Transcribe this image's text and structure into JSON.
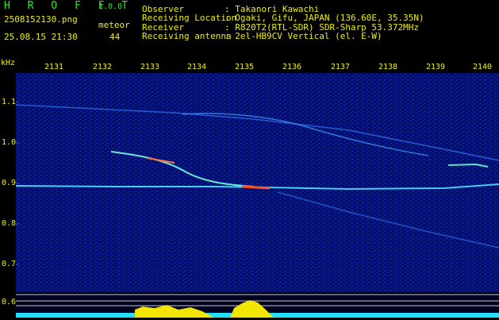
{
  "app": {
    "name": "H R O F F T",
    "version": "1.0.0"
  },
  "capture": {
    "file_name": "2508152130.png",
    "timestamp": "25.08.15 21:30",
    "mode_label": "meteor",
    "mode_count": "44"
  },
  "info": [
    {
      "label": "Observer",
      "value": ": Takanori Kawachi"
    },
    {
      "label": "Receiving Location",
      "value": ": Ogaki, Gifu, JAPAN (136.60E, 35.35N)"
    },
    {
      "label": "Receiver",
      "value": ": R820T2(RTL-SDR) SDR-Sharp 53.372MHz"
    },
    {
      "label": "Receiving antenna",
      "value": ": 2el-HB9CV Vertical (el. E-W)"
    }
  ],
  "axes": {
    "unit": "kHz",
    "x_ticks": [
      "2131",
      "2132",
      "2133",
      "2134",
      "2135",
      "2136",
      "2137",
      "2138",
      "2139",
      "2140"
    ],
    "y_ticks": [
      "1.1",
      "1.0",
      "0.9",
      "0.8",
      "0.7",
      "0.6"
    ]
  },
  "colors": {
    "background": "#000000",
    "text": "#f0f000",
    "title": "#22ee22",
    "spectrogram_bg": "#000f6e",
    "noise_level": "#22e0ff",
    "signal_peak": "#f2e600"
  }
}
